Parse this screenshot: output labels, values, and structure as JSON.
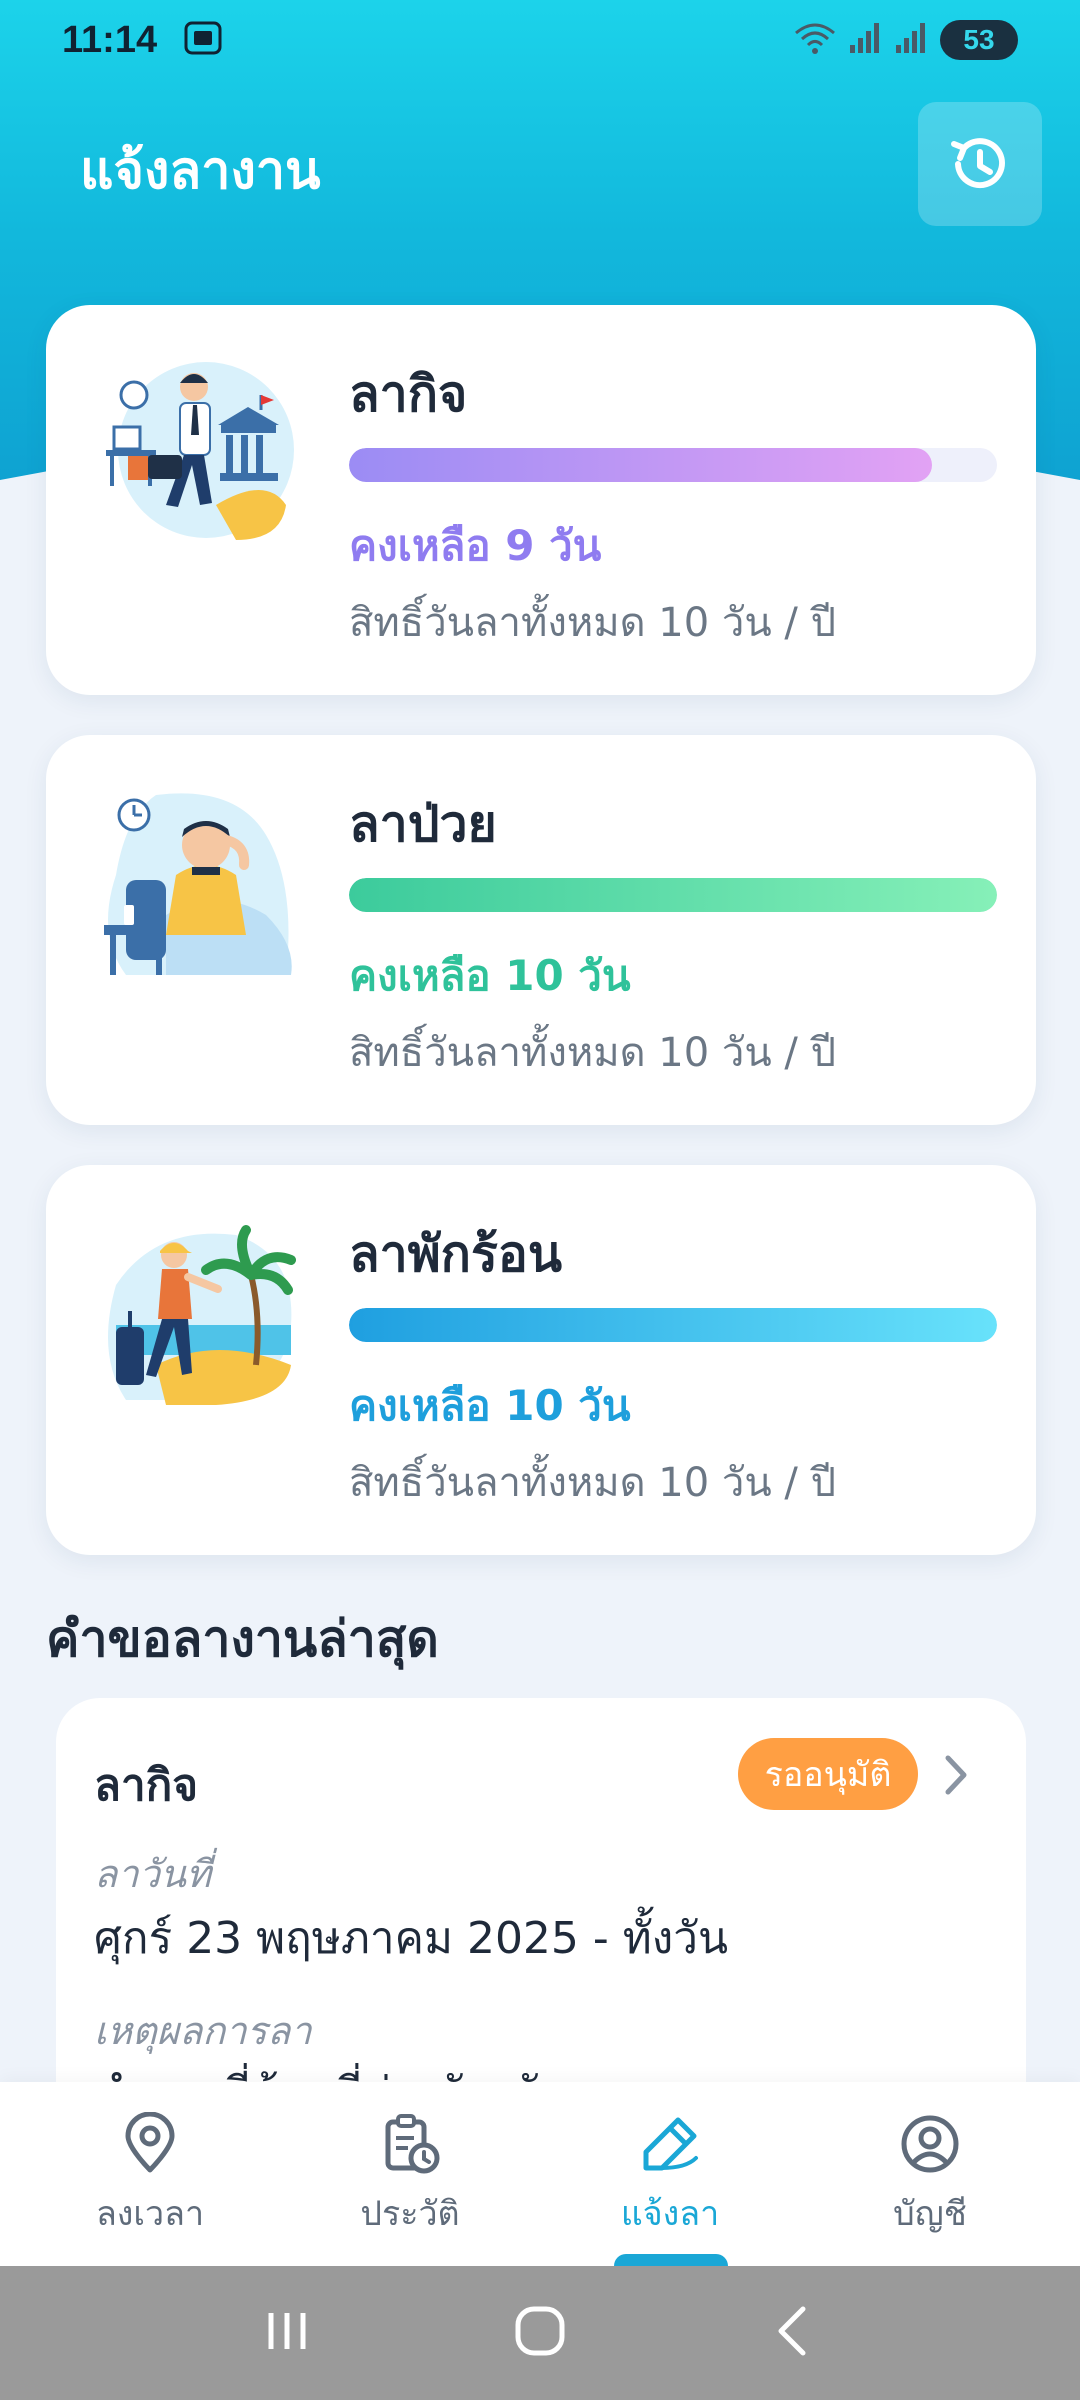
{
  "status_bar": {
    "time": "11:14",
    "battery": "53",
    "icons": [
      "screenshot-icon",
      "wifi-icon",
      "signal-icon",
      "signal-icon",
      "battery-icon"
    ]
  },
  "header": {
    "title": "แจ้งลางาน",
    "history_icon": "history-icon"
  },
  "leave_cards": [
    {
      "title": "ลากิจ",
      "remaining": "คงเหลือ 9 วัน",
      "total": "สิทธิ์วันลาทั้งหมด 10 วัน / ปี",
      "remaining_fraction": 0.9,
      "color": "#8f7cf0",
      "gradient": [
        "#9b8cf4",
        "#e2a2f4"
      ],
      "illustration": "business-leave-illustration"
    },
    {
      "title": "ลาป่วย",
      "remaining": "คงเหลือ 10 วัน",
      "total": "สิทธิ์วันลาทั้งหมด 10 วัน / ปี",
      "remaining_fraction": 1.0,
      "color": "#2fc29a",
      "gradient": [
        "#3ccb9c",
        "#86f0b8"
      ],
      "illustration": "sick-leave-illustration"
    },
    {
      "title": "ลาพักร้อน",
      "remaining": "คงเหลือ 10 วัน",
      "total": "สิทธิ์วันลาทั้งหมด 10 วัน / ปี",
      "remaining_fraction": 1.0,
      "color": "#1e9fdc",
      "gradient": [
        "#1f9fe0",
        "#68e2fb"
      ],
      "illustration": "vacation-leave-illustration"
    }
  ],
  "latest_requests": {
    "title": "คำขอลางานล่าสุด",
    "items": [
      {
        "type": "ลากิจ",
        "status": "รออนุมัติ",
        "status_color": "#ff9f43",
        "date_label": "ลาวันที่",
        "date_value": "ศุกร์ 23 พฤษภาคม 2025 - ทั้งวัน",
        "reason_label": "เหตุผลการลา",
        "reason_value": "ทำธุระที่บ้านที่ต่างจังหวัด"
      }
    ]
  },
  "bottom_nav": {
    "items": [
      {
        "label": "ลงเวลา",
        "icon": "location-pin-icon"
      },
      {
        "label": "ประวัติ",
        "icon": "clipboard-clock-icon"
      },
      {
        "label": "แจ้งลา",
        "icon": "pencil-icon",
        "active": true
      },
      {
        "label": "บัญชี",
        "icon": "user-circle-icon"
      }
    ]
  },
  "accent_color": "#1aa7d6"
}
